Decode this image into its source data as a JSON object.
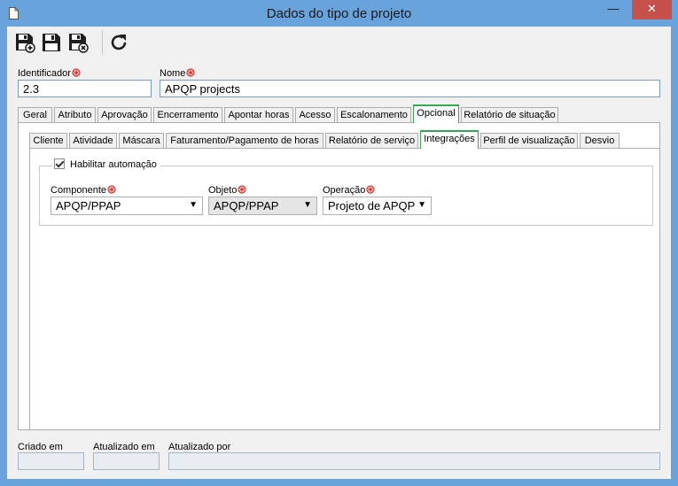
{
  "window": {
    "title": "Dados do tipo de projeto",
    "close_glyph": "✕",
    "min_glyph": "—",
    "max_glyph": "☐"
  },
  "toolbar": {
    "icons": [
      "save-new-icon",
      "save-icon",
      "save-close-icon",
      "refresh-icon"
    ]
  },
  "fields": {
    "identificador": {
      "label": "Identificador",
      "value": "2.3"
    },
    "nome": {
      "label": "Nome",
      "value": "APQP projects"
    }
  },
  "main_tabs": [
    "Geral",
    "Atributo",
    "Aprovação",
    "Encerramento",
    "Apontar horas",
    "Acesso",
    "Escalonamento",
    "Opcional",
    "Relatório de situação"
  ],
  "main_active": "Opcional",
  "sub_tabs": [
    "Cliente",
    "Atividade",
    "Máscara",
    "Faturamento/Pagamento de horas",
    "Relatório de serviço",
    "Integrações",
    "Perfil de visualização",
    "Desvio"
  ],
  "sub_active": "Integrações",
  "integracoes": {
    "habilitar_label": "Habilitar automação",
    "habilitar_checked": true,
    "componente": {
      "label": "Componente",
      "value": "APQP/PPAP"
    },
    "objeto": {
      "label": "Objeto",
      "value": "APQP/PPAP"
    },
    "operacao": {
      "label": "Operação",
      "value": "Projeto de APQP"
    },
    "arrow": "▼"
  },
  "footer": {
    "criado_em": {
      "label": "Criado em",
      "value": ""
    },
    "atualizado_em": {
      "label": "Atualizado em",
      "value": ""
    },
    "atualizado_por": {
      "label": "Atualizado por",
      "value": ""
    }
  },
  "colors": {
    "titlebar": "#68a3dc",
    "close": "#c7504b",
    "active_tab_border": "#34a853",
    "required": "#d9302c"
  }
}
